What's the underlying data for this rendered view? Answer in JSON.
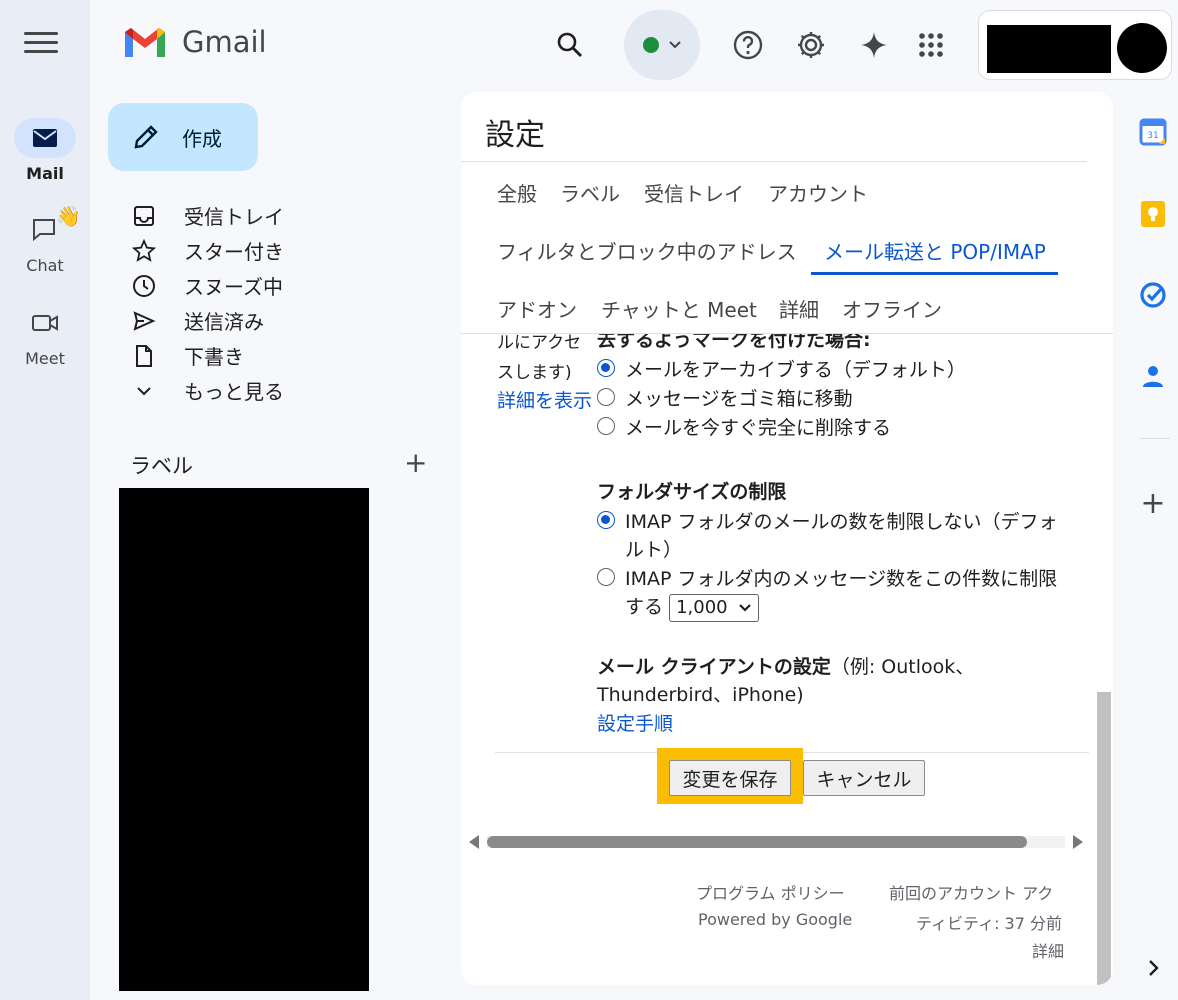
{
  "app": {
    "name": "Gmail"
  },
  "rail": {
    "items": [
      {
        "label": "Mail",
        "icon": "mail-icon",
        "active": true
      },
      {
        "label": "Chat",
        "icon": "chat-icon",
        "active": false
      },
      {
        "label": "Meet",
        "icon": "video-icon",
        "active": false
      }
    ]
  },
  "compose": {
    "label": "作成"
  },
  "nav": {
    "items": [
      {
        "label": "受信トレイ",
        "icon": "inbox-icon"
      },
      {
        "label": "スター付き",
        "icon": "star-icon"
      },
      {
        "label": "スヌーズ中",
        "icon": "clock-icon"
      },
      {
        "label": "送信済み",
        "icon": "send-icon"
      },
      {
        "label": "下書き",
        "icon": "draft-icon"
      },
      {
        "label": "もっと見る",
        "icon": "chevron-down-icon"
      }
    ]
  },
  "labels": {
    "title": "ラベル"
  },
  "settings": {
    "title": "設定",
    "tabs_row1": [
      "全般",
      "ラベル",
      "受信トレイ",
      "アカウント"
    ],
    "tabs_row2": [
      "フィルタとブロック中のアドレス",
      "メール転送と POP/IMAP"
    ],
    "tabs_row3": [
      "アドオン",
      "チャットと Meet",
      "詳細",
      "オフライン"
    ],
    "active_tab": "メール転送と POP/IMAP",
    "expunge": {
      "side_line1": "ルにアクセ",
      "side_line2": "スします)",
      "side_link": "詳細を表示",
      "header_cut": "去するようマークを付けた場合:",
      "options": [
        {
          "label": "メールをアーカイブする（デフォルト）",
          "checked": true
        },
        {
          "label": "メッセージをゴミ箱に移動",
          "checked": false
        },
        {
          "label": "メールを今すぐ完全に削除する",
          "checked": false
        }
      ]
    },
    "folder_size": {
      "title": "フォルダサイズの制限",
      "opt1_line1": "IMAP フォルダのメールの数を制限しない（デフォ",
      "opt1_line2": "ルト）",
      "opt2_line1": "IMAP フォルダ内のメッセージ数をこの件数に制限",
      "opt2_line2": "する",
      "select_value": "1,000",
      "opt1_checked": true,
      "opt2_checked": false
    },
    "client": {
      "title": "メール クライアントの設定",
      "example_line1": "（例: Outlook、",
      "example_line2": "Thunderbird、iPhone)",
      "link": "設定手順"
    },
    "buttons": {
      "save": "変更を保存",
      "cancel": "キャンセル"
    }
  },
  "footer": {
    "policy": "プログラム ポリシー",
    "powered": "Powered by Google",
    "activity_line1": "前回のアカウント アク",
    "activity_line2": "ティビティ: 37 分前",
    "details": "詳細"
  },
  "colors": {
    "accent": "#0b57d0",
    "compose_bg": "#c2e7ff",
    "highlight": "#fbbc04"
  }
}
